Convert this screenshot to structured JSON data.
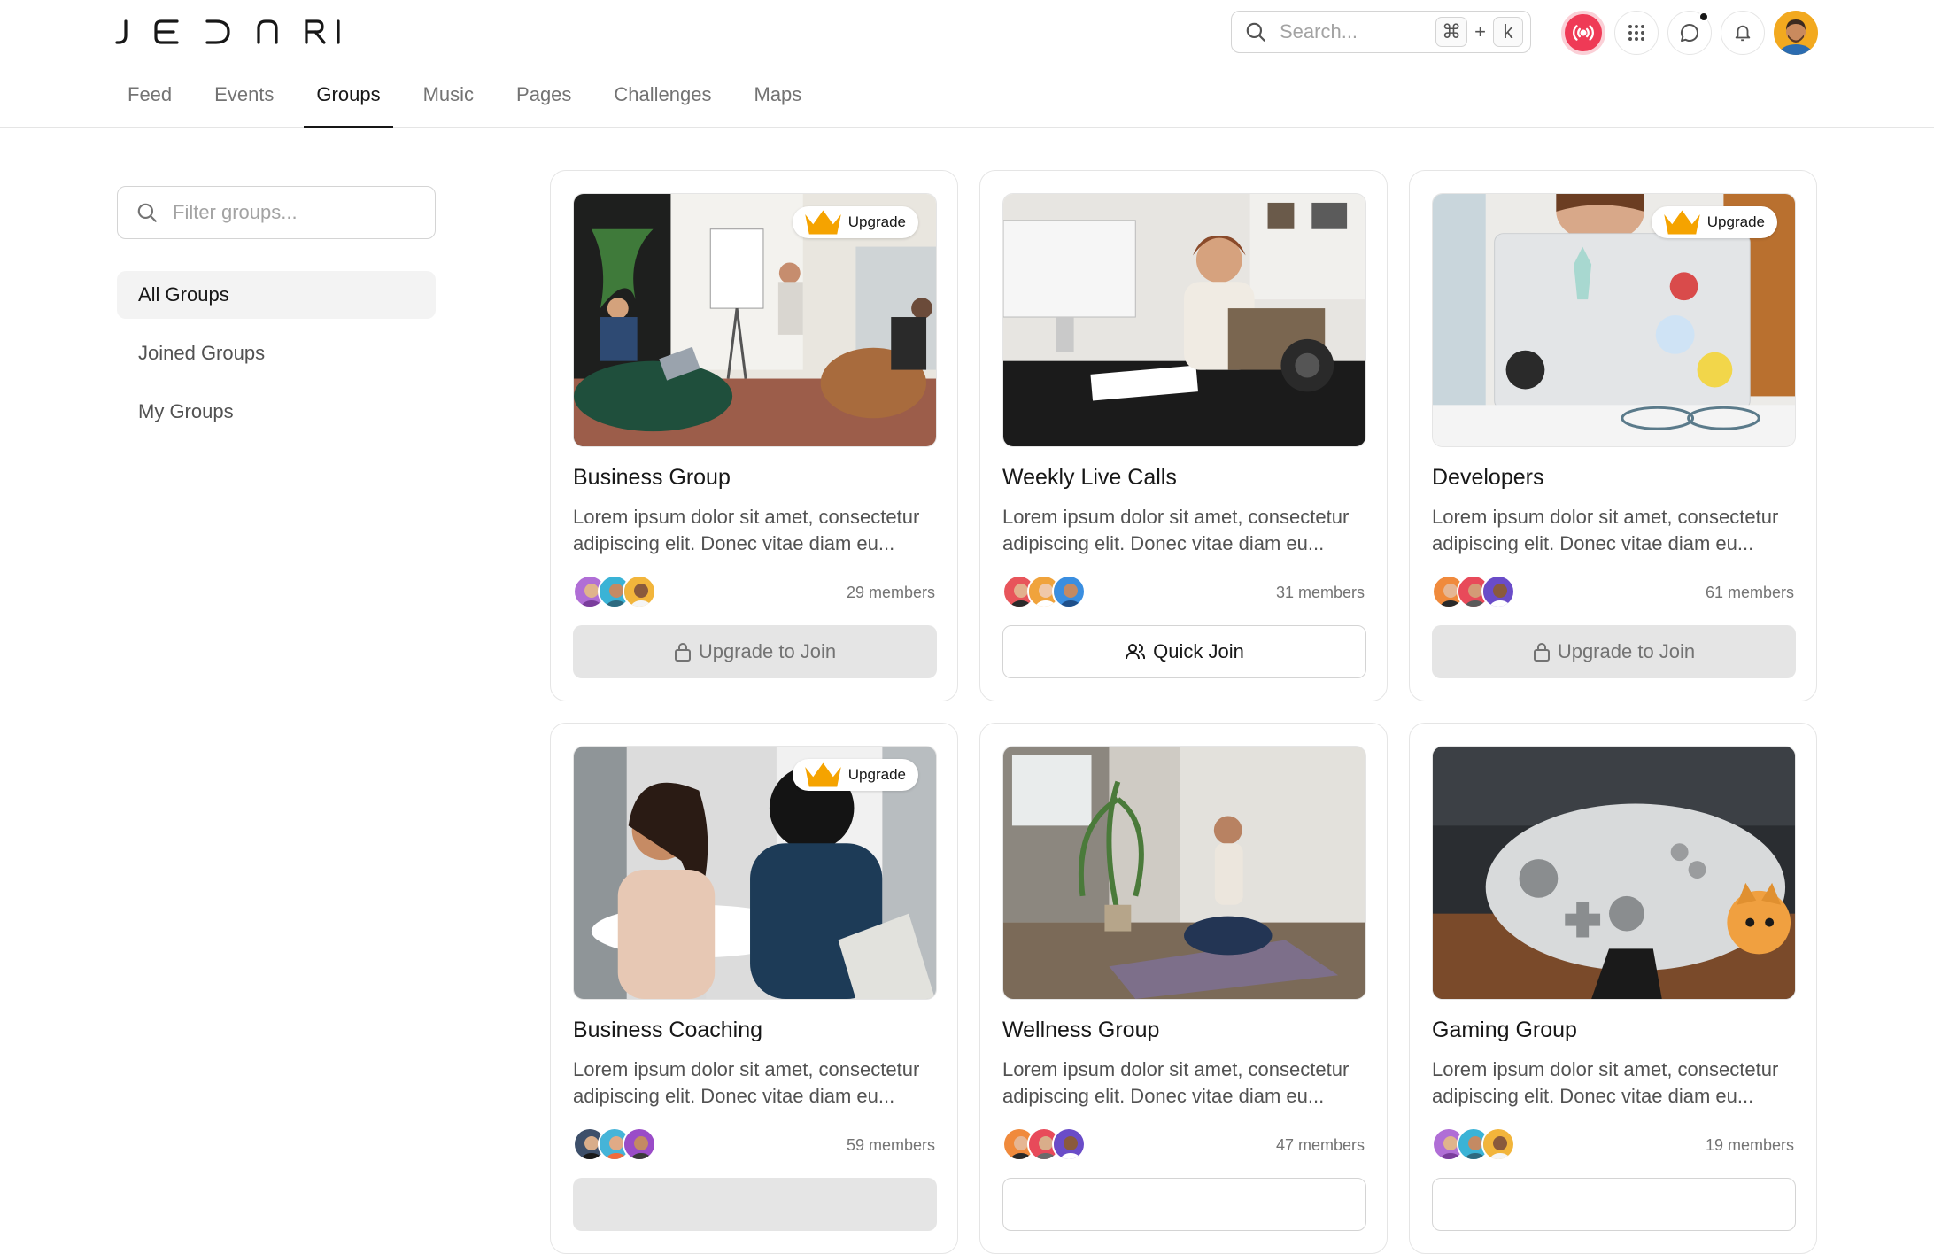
{
  "brand": {
    "logo_text": "JEDNRI"
  },
  "header": {
    "search": {
      "placeholder": "Search...",
      "shortcut_mod": "⌘",
      "shortcut_plus": "+",
      "shortcut_key": "k"
    },
    "live_color": "#ef3a56"
  },
  "nav": {
    "tabs": [
      "Feed",
      "Events",
      "Groups",
      "Music",
      "Pages",
      "Challenges",
      "Maps"
    ],
    "active": "Groups"
  },
  "sidebar": {
    "filter_placeholder": "Filter groups...",
    "items": [
      "All Groups",
      "Joined Groups",
      "My Groups"
    ],
    "active": "All Groups"
  },
  "groups": [
    {
      "title": "Business Group",
      "description": "Lorem ipsum dolor sit amet, consectetur adipiscing elit. Donec vitae diam eu...",
      "members": "29 members",
      "badge": "Upgrade",
      "action": "Upgrade to Join",
      "action_type": "locked"
    },
    {
      "title": "Weekly Live Calls",
      "description": "Lorem ipsum dolor sit amet, consectetur adipiscing elit. Donec vitae diam eu...",
      "members": "31 members",
      "badge": "",
      "action": "Quick Join",
      "action_type": "join"
    },
    {
      "title": "Developers",
      "description": "Lorem ipsum dolor sit amet, consectetur adipiscing elit. Donec vitae diam eu...",
      "members": "61 members",
      "badge": "Upgrade",
      "action": "Upgrade to Join",
      "action_type": "locked"
    },
    {
      "title": "Business Coaching",
      "description": "Lorem ipsum dolor sit amet, consectetur adipiscing elit. Donec vitae diam eu...",
      "members": "59 members",
      "badge": "Upgrade",
      "action": "",
      "action_type": "locked"
    },
    {
      "title": "Wellness Group",
      "description": "Lorem ipsum dolor sit amet, consectetur adipiscing elit. Donec vitae diam eu...",
      "members": "47 members",
      "badge": "",
      "action": "",
      "action_type": "join"
    },
    {
      "title": "Gaming Group",
      "description": "Lorem ipsum dolor sit amet, consectetur adipiscing elit. Donec vitae diam eu...",
      "members": "19 members",
      "badge": "",
      "action": "",
      "action_type": "join"
    }
  ]
}
